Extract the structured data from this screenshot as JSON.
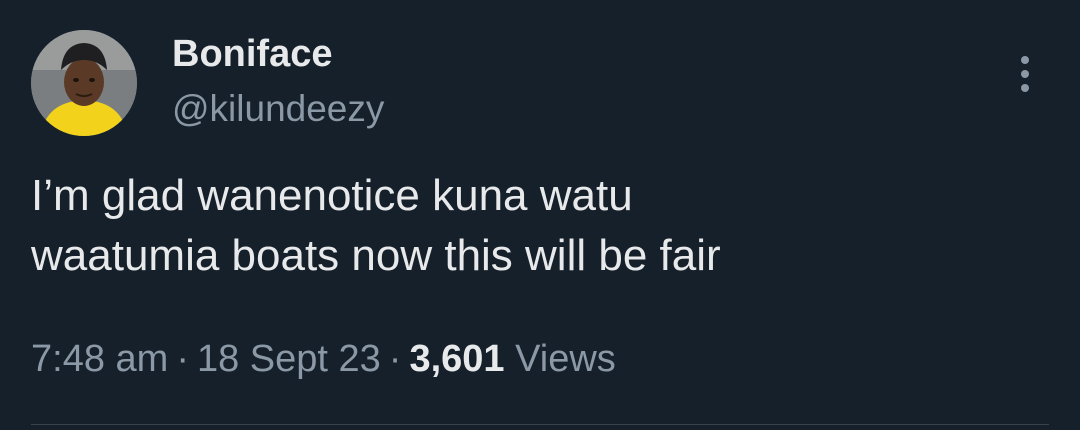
{
  "tweet": {
    "author": {
      "display_name": "Boniface",
      "handle": "@kilundeezy",
      "avatar_icon": "profile-photo"
    },
    "text_lines": [
      "I’m glad wanenotice kuna watu",
      "waatumia boats now this will be fair"
    ],
    "meta": {
      "time": "7:48 am",
      "date": "18 Sept 23",
      "separator": "·",
      "views_count": "3,601",
      "views_label": "Views"
    },
    "more_icon": "more-vertical-icon"
  },
  "colors": {
    "background": "#15202b",
    "primary_text": "#e7e9ea",
    "secondary_text": "#8b98a5",
    "divider": "#38444d"
  }
}
